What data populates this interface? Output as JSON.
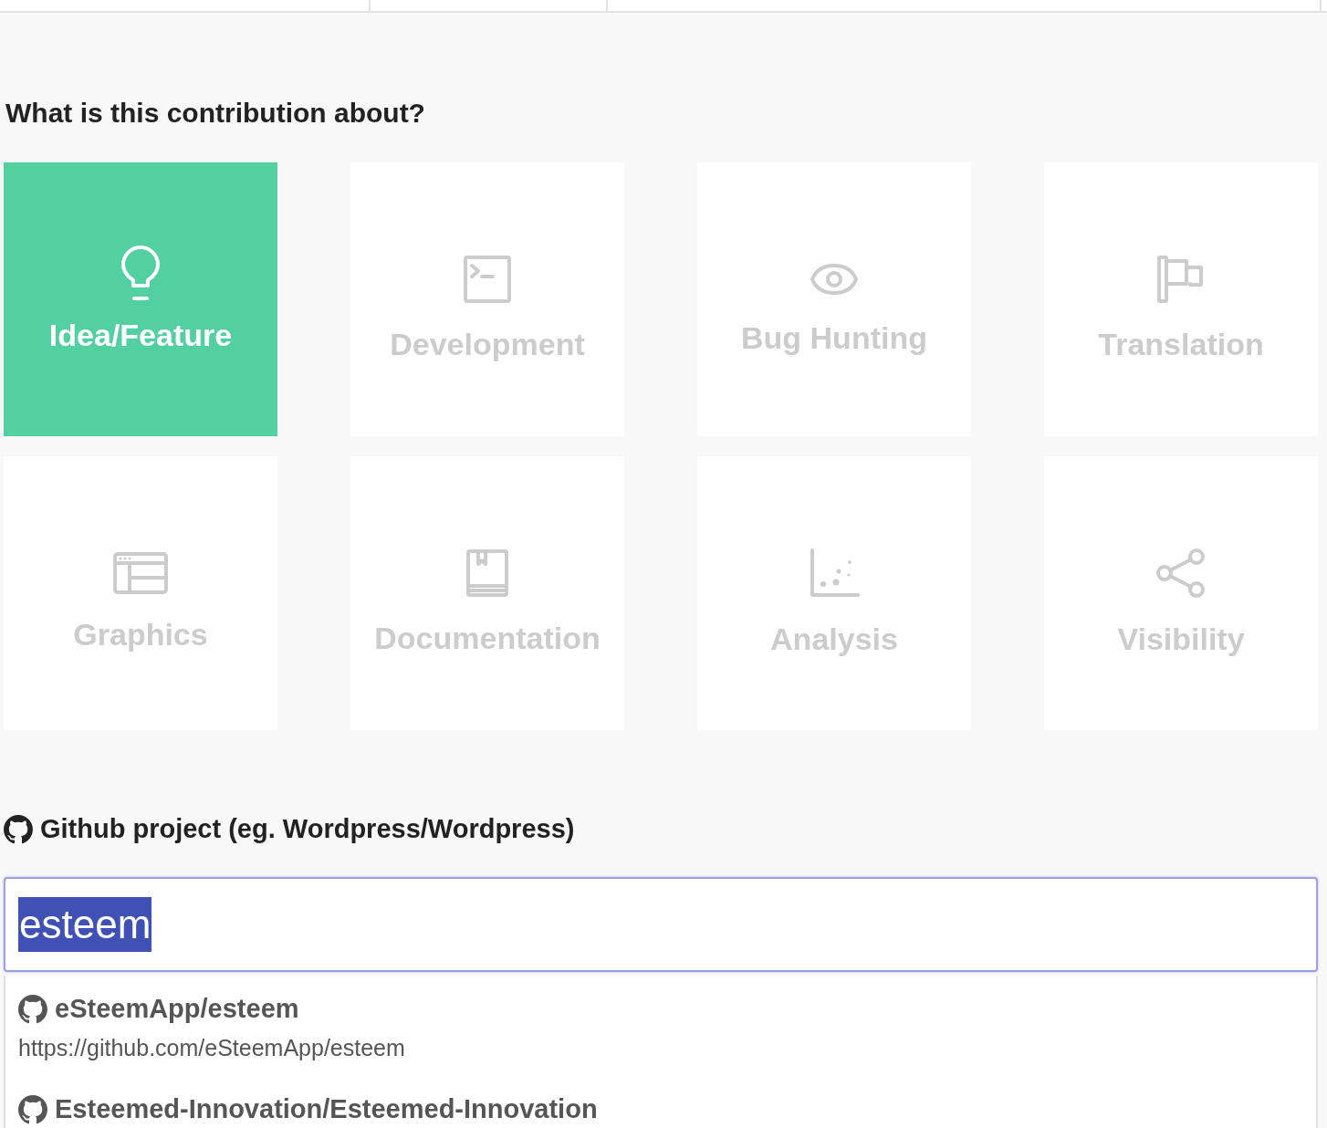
{
  "heading": "What is this contribution about?",
  "categories": [
    {
      "label": "Idea/Feature",
      "selected": true
    },
    {
      "label": "Development",
      "selected": false
    },
    {
      "label": "Bug Hunting",
      "selected": false
    },
    {
      "label": "Translation",
      "selected": false
    },
    {
      "label": "Graphics",
      "selected": false
    },
    {
      "label": "Documentation",
      "selected": false
    },
    {
      "label": "Analysis",
      "selected": false
    },
    {
      "label": "Visibility",
      "selected": false
    }
  ],
  "repo_field": {
    "label": "Github project (eg. Wordpress/Wordpress)",
    "value": "esteem",
    "text_selected": true
  },
  "suggestions": [
    {
      "name": "eSteemApp/esteem",
      "url": "https://github.com/eSteemApp/esteem"
    },
    {
      "name": "Esteemed-Innovation/Esteemed-Innovation"
    }
  ]
}
